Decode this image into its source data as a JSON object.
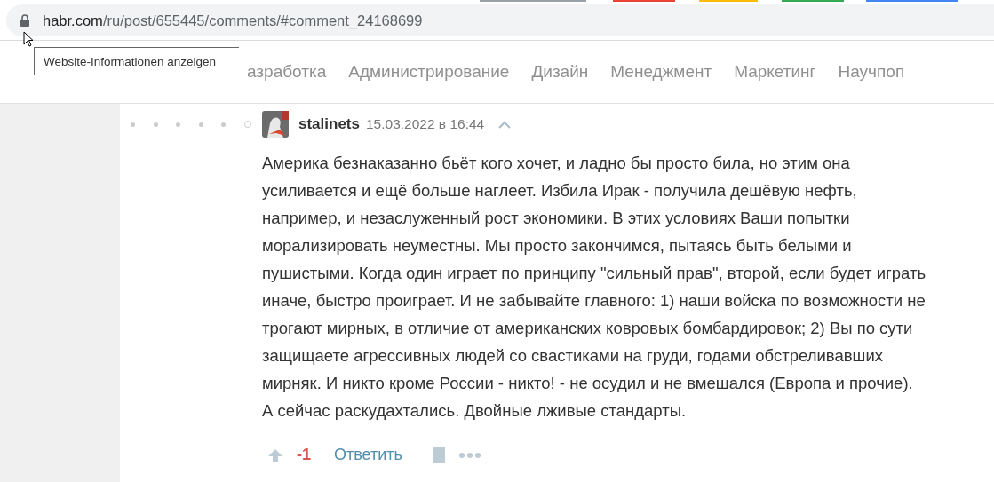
{
  "address_bar": {
    "domain": "habr.com",
    "path": "/ru/post/655445/comments/#comment_24168699"
  },
  "tooltip": "Website-Informationen anzeigen",
  "nav": [
    {
      "label": "азработка"
    },
    {
      "label": "Администрирование"
    },
    {
      "label": "Дизайн"
    },
    {
      "label": "Менеджмент"
    },
    {
      "label": "Маркетинг"
    },
    {
      "label": "Научпоп"
    }
  ],
  "comment": {
    "thread_dots": [
      {
        "selected": false
      },
      {
        "selected": false
      },
      {
        "selected": false
      },
      {
        "selected": false
      },
      {
        "selected": false
      },
      {
        "selected": true
      }
    ],
    "author": "stalinets",
    "date": "15.03.2022 в 16:44",
    "text": "Америка безнаказанно бьёт кого хочет, и ладно бы просто била, но этим она усиливается и ещё больше наглеет. Избила Ирак - получила дешёвую нефть, например, и незаслуженный рост экономики. В этих условиях Ваши попытки морализировать неуместны. Мы просто закончимся, пытаясь быть белыми и пушистыми. Когда один играет по принципу \"сильный прав\", второй, если будет играть иначе, быстро проиграет. И не забывайте главного: 1) наши войска по возможности не трогают мирных, в отличие от американских ковровых бомбардировок; 2) Вы по сути защищаете агрессивных людей со свастиками на груди, годами обстреливавших мирняк. И никто кроме России - никто! - не осудил и не вмешался (Европа и прочие). А сейчас раскудахтались. Двойные лживые стандарты.",
    "score": "-1",
    "reply": "Ответить"
  }
}
